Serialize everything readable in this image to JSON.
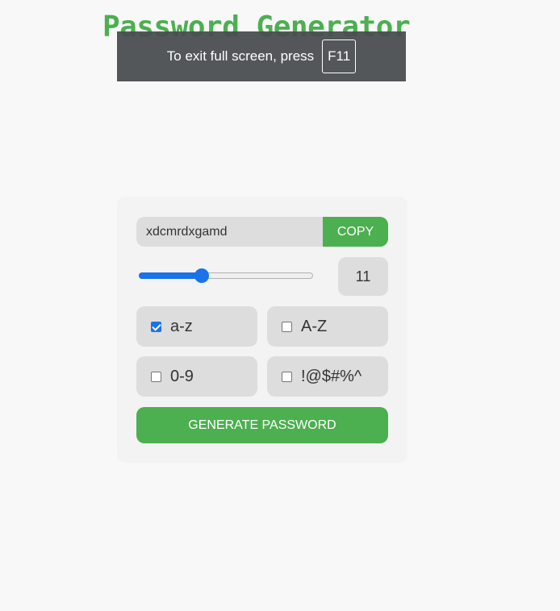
{
  "app": {
    "title": "Password Generator"
  },
  "fullscreen_notice": {
    "text": "To exit full screen, press",
    "key": "F11"
  },
  "generator": {
    "password": "xdcmrdxgamd",
    "copy_label": "COPY",
    "length": "11",
    "length_fraction": 0.36,
    "options": {
      "lowercase": {
        "label": "a-z",
        "checked": true
      },
      "uppercase": {
        "label": "A-Z",
        "checked": false
      },
      "numbers": {
        "label": "0-9",
        "checked": false
      },
      "symbols": {
        "label": "!@$#%^",
        "checked": false
      }
    },
    "generate_label": "GENERATE PASSWORD"
  },
  "colors": {
    "accent": "#4caf50",
    "slider": "#1a73e8",
    "field_bg": "#dddddd",
    "page_bg": "#f8f8f8"
  }
}
